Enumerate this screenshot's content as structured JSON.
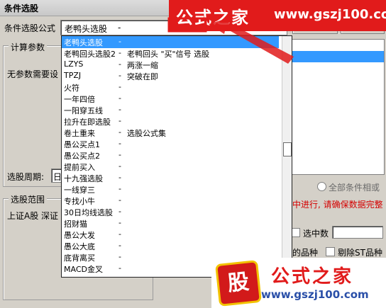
{
  "window": {
    "title": "条件选股"
  },
  "formula": {
    "label": "条件选股公式",
    "selected_name": "老鸭头选股",
    "selected_desc": "-"
  },
  "params_group": {
    "title": "计算参数",
    "no_params_text": "无参数需要设"
  },
  "period": {
    "label": "选股周期:",
    "value": "日"
  },
  "scope_group": {
    "title": "选股范围",
    "markets_text": "上证A股  深证"
  },
  "dropdown_items": [
    {
      "name": "老鸭头选股",
      "dash": "-",
      "extra": "",
      "selected": true
    },
    {
      "name": "老鸭回头选股2",
      "dash": "-",
      "extra": "老鸭回头 \"买\"信号 选股",
      "selected": false
    },
    {
      "name": "LZYS",
      "dash": "-",
      "extra": "两涨一缩",
      "selected": false
    },
    {
      "name": "TPZJ",
      "dash": "-",
      "extra": "突破在即",
      "selected": false
    },
    {
      "name": "火符",
      "dash": "-",
      "extra": "",
      "selected": false
    },
    {
      "name": "一年四倍",
      "dash": "-",
      "extra": "",
      "selected": false
    },
    {
      "name": "一阳穿五线",
      "dash": "-",
      "extra": "",
      "selected": false
    },
    {
      "name": "拉升在即选股",
      "dash": "-",
      "extra": "",
      "selected": false
    },
    {
      "name": "卷土重来",
      "dash": "-",
      "extra": "选股公式集",
      "selected": false
    },
    {
      "name": "愚公买点1",
      "dash": "-",
      "extra": "",
      "selected": false
    },
    {
      "name": "愚公买点2",
      "dash": "-",
      "extra": "",
      "selected": false
    },
    {
      "name": "提前买入",
      "dash": "-",
      "extra": "",
      "selected": false
    },
    {
      "name": "十九强选股",
      "dash": "-",
      "extra": "",
      "selected": false
    },
    {
      "name": "一线穿三",
      "dash": "-",
      "extra": "",
      "selected": false
    },
    {
      "name": "专找小牛",
      "dash": "-",
      "extra": "",
      "selected": false
    },
    {
      "name": "30日均线选股",
      "dash": "-",
      "extra": "",
      "selected": false
    },
    {
      "name": "招财猫",
      "dash": "-",
      "extra": "",
      "selected": false
    },
    {
      "name": "愚公大发",
      "dash": "-",
      "extra": "",
      "selected": false
    },
    {
      "name": "愚公大底",
      "dash": "-",
      "extra": "",
      "selected": false
    },
    {
      "name": "底背离买",
      "dash": "-",
      "extra": "",
      "selected": false
    },
    {
      "name": "MACD金叉",
      "dash": "-",
      "extra": "",
      "selected": false
    }
  ],
  "right_panel": {
    "all_conditions_label": "全部条件相或",
    "warning_text": "中进行, 请确保数据完整",
    "in_count_label": "选中数",
    "stock_types_partial": "的品种",
    "exclude_st_label": "剔除ST品种"
  },
  "watermark_top": {
    "text": "公式之家",
    "url": "www.gszj100.com"
  },
  "watermark_bottom": {
    "logo_char": "股",
    "text": "公式之家",
    "url": "www.gszj100.com"
  }
}
